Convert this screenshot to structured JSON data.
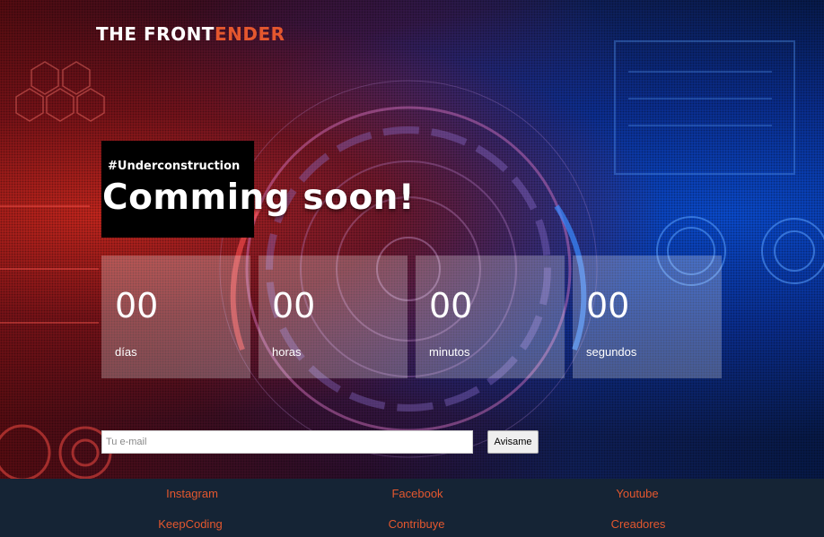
{
  "brand": {
    "name_part1": "THE FRONT",
    "name_part2": "ENDER"
  },
  "hero": {
    "tagline": "#Underconstruction",
    "headline": "Comming soon!"
  },
  "countdown": [
    {
      "value": "00",
      "label": "días"
    },
    {
      "value": "00",
      "label": "horas"
    },
    {
      "value": "00",
      "label": "minutos"
    },
    {
      "value": "00",
      "label": "segundos"
    }
  ],
  "subscribe": {
    "email_placeholder": "Tu e-mail",
    "button_label": "Avisame"
  },
  "footer": {
    "links": [
      "Instagram",
      "Facebook",
      "Youtube",
      "KeepCoding",
      "Contribuye",
      "Creadores"
    ]
  },
  "colors": {
    "accent": "#e4572e",
    "footer_bg": "#152435",
    "counter_bg": "rgba(255,255,255,0.25)"
  }
}
